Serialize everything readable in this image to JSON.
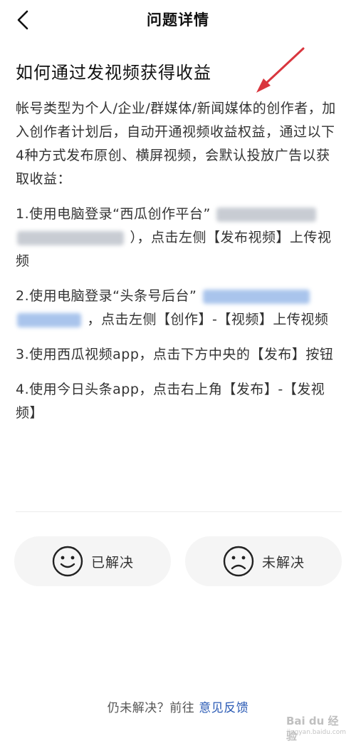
{
  "header": {
    "title": "问题详情"
  },
  "article": {
    "title": "如何通过发视频获得收益",
    "intro": "帐号类型为个人/企业/群媒体/新闻媒体的创作者，加入创作者计划后，自动开通视频收益权益，通过以下4种方式发布原创、横屏视频，会默认投放广告以获取收益：",
    "step1": {
      "prefix": "1.使用电脑登录“西瓜创作平台”",
      "suffix": "），点击左侧【发布视频】上传视频"
    },
    "step2": {
      "prefix": "2.使用电脑登录“头条号后台”",
      "suffix": "，点击左侧【创作】-【视频】上传视频"
    },
    "step3": "3.使用西瓜视频app，点击下方中央的【发布】按钮",
    "step4": "4.使用今日头条app，点击右上角【发布】-【发视频】"
  },
  "feedback": {
    "solved": "已解决",
    "unsolved": "未解决"
  },
  "footer": {
    "text": "仍未解决？前往 ",
    "link": "意见反馈"
  },
  "watermark": {
    "brand": "Bai du 经验",
    "url": "jingyan.baidu.com"
  },
  "colors": {
    "link": "#2b5bb5",
    "annotation_arrow": "#d9363e",
    "button_bg": "#f5f5f5"
  }
}
